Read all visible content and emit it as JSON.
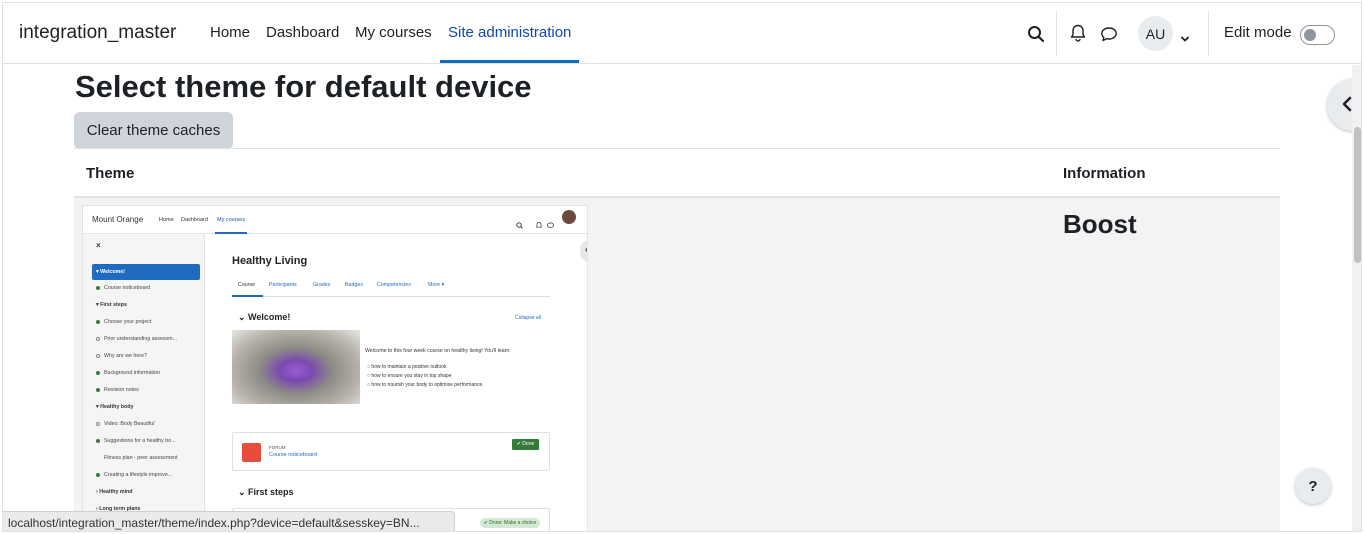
{
  "navbar": {
    "brand": "integration_master",
    "links": [
      "Home",
      "Dashboard",
      "My courses",
      "Site administration"
    ],
    "avatar_initials": "AU",
    "edit_mode_label": "Edit mode",
    "icons": [
      "search-icon",
      "bell-icon",
      "chat-icon",
      "chevron-down-icon"
    ]
  },
  "page": {
    "title": "Select theme for default device",
    "clear_button": "Clear theme caches"
  },
  "table": {
    "headers": [
      "Theme",
      "Information"
    ],
    "rows": [
      {
        "theme_name": "Boost"
      }
    ]
  },
  "preview": {
    "brand": "Mount Orange",
    "nav": [
      "Home",
      "Dashboard",
      "My courses"
    ],
    "sidebar": [
      "Welcome!",
      "Course noticeboard",
      "First steps",
      "Choose your project",
      "Prior understanding assessm...",
      "Why are we here?",
      "Background information",
      "Revision notes",
      "Healthy body",
      "Video: Body Beautiful",
      "Suggestions for a healthy bo...",
      "Fitness plan - peer assessment",
      "Creating a lifestyle improve...",
      "Healthy mind",
      "Long term plans"
    ],
    "course_title": "Healthy Living",
    "tabs": [
      "Course",
      "Participants",
      "Grades",
      "Badges",
      "Competencies",
      "More ▾"
    ],
    "section1": "Welcome!",
    "collapse_all": "Collapse all",
    "intro": "Welcome to this four week course on healthy living! You'll learn:",
    "bullets": [
      "how to maintain a positive outlook",
      "how to ensure you stay in top shape",
      "how to nourish your body to optimise performance."
    ],
    "forum_label": "FORUM",
    "forum_link": "Course noticeboard",
    "done": "✔ Done",
    "section2": "First steps",
    "done_choice": "✔ Done: Make a choice"
  },
  "help_label": "?",
  "status_url": "localhost/integration_master/theme/index.php?device=default&sesskey=BN...",
  "colors": {
    "accent": "#0f6cbf",
    "button_bg": "#ced4da",
    "row_bg": "#f3f3f4"
  }
}
